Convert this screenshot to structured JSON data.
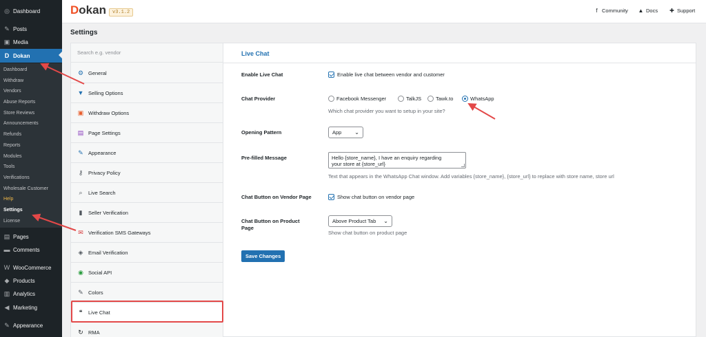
{
  "wp_sidebar": {
    "items": [
      {
        "label": "Dashboard",
        "icon": "dashboard-icon",
        "glyph": "◎"
      },
      {
        "label": "Posts",
        "icon": "pushpin-icon",
        "glyph": "✎"
      },
      {
        "label": "Media",
        "icon": "media-icon",
        "glyph": "▣"
      },
      {
        "label": "Dokan",
        "icon": "dokan-icon",
        "glyph": "D"
      },
      {
        "label": "Pages",
        "icon": "pages-icon",
        "glyph": "▤"
      },
      {
        "label": "Comments",
        "icon": "comments-icon",
        "glyph": "▬"
      },
      {
        "label": "WooCommerce",
        "icon": "woocommerce-icon",
        "glyph": "W"
      },
      {
        "label": "Products",
        "icon": "products-icon",
        "glyph": "◆"
      },
      {
        "label": "Analytics",
        "icon": "analytics-icon",
        "glyph": "▥"
      },
      {
        "label": "Marketing",
        "icon": "marketing-icon",
        "glyph": "◀"
      },
      {
        "label": "Appearance",
        "icon": "appearance-icon",
        "glyph": "✎"
      }
    ],
    "submenu": [
      "Dashboard",
      "Withdraw",
      "Vendors",
      "Abuse Reports",
      "Store Reviews",
      "Announcements",
      "Refunds",
      "Reports",
      "Modules",
      "Tools",
      "Verifications",
      "Wholesale Customer",
      "Help",
      "Settings",
      "License"
    ]
  },
  "topbar": {
    "logo_first": "D",
    "logo_rest": "okan",
    "version": "v3.1.2",
    "links": [
      {
        "label": "Community",
        "icon": "facebook-icon",
        "glyph": "f"
      },
      {
        "label": "Docs",
        "icon": "graduation-cap-icon",
        "glyph": "▲"
      },
      {
        "label": "Support",
        "icon": "lifebuoy-icon",
        "glyph": "✚"
      }
    ]
  },
  "page_title": "Settings",
  "settings_nav": {
    "search_placeholder": "Search e.g. vendor",
    "items": [
      {
        "label": "General",
        "icon": "gear-icon",
        "glyph": "⚙",
        "color": "#2271b1"
      },
      {
        "label": "Selling Options",
        "icon": "cart-icon",
        "glyph": "▼",
        "color": "#2271b1"
      },
      {
        "label": "Withdraw Options",
        "icon": "withdraw-icon",
        "glyph": "▣",
        "color": "#e85d2c"
      },
      {
        "label": "Page Settings",
        "icon": "page-icon",
        "glyph": "▤",
        "color": "#8a3ebd"
      },
      {
        "label": "Appearance",
        "icon": "brush-icon",
        "glyph": "✎",
        "color": "#2271b1"
      },
      {
        "label": "Privacy Policy",
        "icon": "key-icon",
        "glyph": "⚷",
        "color": "#50575e"
      },
      {
        "label": "Live Search",
        "icon": "search-icon",
        "glyph": "⌕",
        "color": "#50575e"
      },
      {
        "label": "Seller Verification",
        "icon": "lock-icon",
        "glyph": "▮",
        "color": "#50575e"
      },
      {
        "label": "Verification SMS Gateways",
        "icon": "envelope-icon",
        "glyph": "✉",
        "color": "#d63638"
      },
      {
        "label": "Email Verification",
        "icon": "shield-icon",
        "glyph": "◈",
        "color": "#50575e"
      },
      {
        "label": "Social API",
        "icon": "social-icon",
        "glyph": "◉",
        "color": "#2a9d3f"
      },
      {
        "label": "Colors",
        "icon": "pen-icon",
        "glyph": "✎",
        "color": "#50575e"
      },
      {
        "label": "Live Chat",
        "icon": "chat-icon",
        "glyph": "❝",
        "color": "#1d2327"
      },
      {
        "label": "RMA",
        "icon": "refresh-icon",
        "glyph": "↻",
        "color": "#1d2327"
      }
    ]
  },
  "live_chat": {
    "title": "Live Chat",
    "enable": {
      "label": "Enable Live Chat",
      "checkbox_text": "Enable live chat between vendor and customer",
      "checked": true
    },
    "provider": {
      "label": "Chat Provider",
      "options": [
        "Facebook Messenger",
        "TalkJS",
        "Tawk.to",
        "WhatsApp"
      ],
      "selected": "WhatsApp",
      "desc": "Which chat provider you want to setup in your site?"
    },
    "opening_pattern": {
      "label": "Opening Pattern",
      "value": "App"
    },
    "prefilled": {
      "label": "Pre-filled Message",
      "value_line1": "Hello {store_name}, I have an enquiry regarding",
      "value_line2": "your store at {store_url}",
      "desc": "Text that appears in the WhatsApp Chat window. Add variables {store_name}, {store_url} to replace with store name, store url"
    },
    "vendor_page": {
      "label": "Chat Button on Vendor Page",
      "checkbox_text": "Show chat button on vendor page",
      "checked": true
    },
    "product_page": {
      "label_line1": "Chat Button on Product",
      "label_line2": "Page",
      "value": "Above Product Tab",
      "desc": "Show chat button on product page"
    },
    "save_label": "Save Changes"
  },
  "colors": {
    "accent": "#2271b1",
    "annotation": "#e34848",
    "sidebar": "#1d2327"
  }
}
